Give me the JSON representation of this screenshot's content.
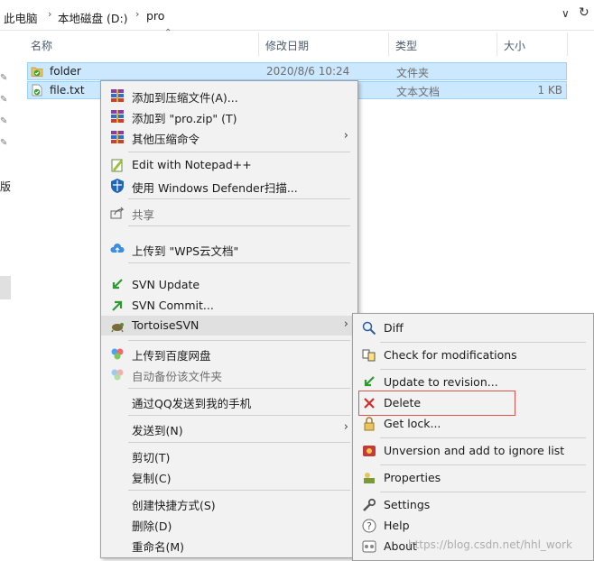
{
  "address": {
    "crumbs": [
      "此电脑",
      "本地磁盘 (D:)",
      "pro"
    ],
    "sep_glyph": "›",
    "dropdown_glyph": "∨",
    "refresh_glyph": "↻"
  },
  "columns": {
    "name": "名称",
    "modified": "修改日期",
    "type": "类型",
    "size": "大小"
  },
  "nav_text": "版",
  "files": [
    {
      "name": "folder",
      "modified": "2020/8/6 10:24",
      "type": "文件夹",
      "size": ""
    },
    {
      "name": "file.txt",
      "modified": "",
      "type": "文本文档",
      "size": "1 KB"
    }
  ],
  "context_menu": {
    "items": [
      {
        "label": "添加到压缩文件(A)...",
        "icon": "winrar-icon"
      },
      {
        "label": "添加到 \"pro.zip\" (T)",
        "icon": "winrar-icon"
      },
      {
        "label": "其他压缩命令",
        "icon": "winrar-icon",
        "submenu": true
      },
      {
        "label": "Edit with Notepad++",
        "icon": "notepad-plus-plus-icon"
      },
      {
        "label": "使用 Windows Defender扫描...",
        "icon": "defender-shield-icon"
      },
      {
        "label": "共享",
        "icon": "share-icon",
        "disabled": true
      },
      {
        "label": "上传到 \"WPS云文档\"",
        "icon": "wps-cloud-icon"
      },
      {
        "label": "SVN Update",
        "icon": "svn-update-icon"
      },
      {
        "label": "SVN Commit...",
        "icon": "svn-commit-icon"
      },
      {
        "label": "TortoiseSVN",
        "icon": "tortoisesvn-icon",
        "submenu": true
      },
      {
        "label": "上传到百度网盘",
        "icon": "baidu-netdisk-icon"
      },
      {
        "label": "自动备份该文件夹",
        "icon": "baidu-netdisk-icon",
        "disabled": true
      },
      {
        "label": "通过QQ发送到我的手机",
        "icon": ""
      },
      {
        "label": "发送到(N)",
        "icon": "",
        "submenu": true
      },
      {
        "label": "剪切(T)",
        "icon": ""
      },
      {
        "label": "复制(C)",
        "icon": ""
      },
      {
        "label": "创建快捷方式(S)",
        "icon": ""
      },
      {
        "label": "删除(D)",
        "icon": ""
      },
      {
        "label": "重命名(M)",
        "icon": ""
      }
    ],
    "arrow_glyph": "›"
  },
  "svn_submenu": {
    "items": [
      {
        "label": "Diff",
        "icon": "magnifier-icon"
      },
      {
        "label": "Check for modifications",
        "icon": "check-modifications-icon"
      },
      {
        "label": "Update to revision...",
        "icon": "update-revision-icon"
      },
      {
        "label": "Delete",
        "icon": "delete-x-icon"
      },
      {
        "label": "Get lock...",
        "icon": "lock-icon"
      },
      {
        "label": "Unversion and add to ignore list",
        "icon": "ignore-list-icon"
      },
      {
        "label": "Properties",
        "icon": "properties-icon"
      },
      {
        "label": "Settings",
        "icon": "settings-wrench-icon"
      },
      {
        "label": "Help",
        "icon": "help-icon"
      },
      {
        "label": "About",
        "icon": "about-icon"
      }
    ]
  },
  "watermark": "https://blog.csdn.net/hhl_work",
  "colors": {
    "selection": "#cce8ff",
    "selection_border": "#99d1ff",
    "menu_bg": "#f2f2f2",
    "highlight": "#d9534f"
  }
}
